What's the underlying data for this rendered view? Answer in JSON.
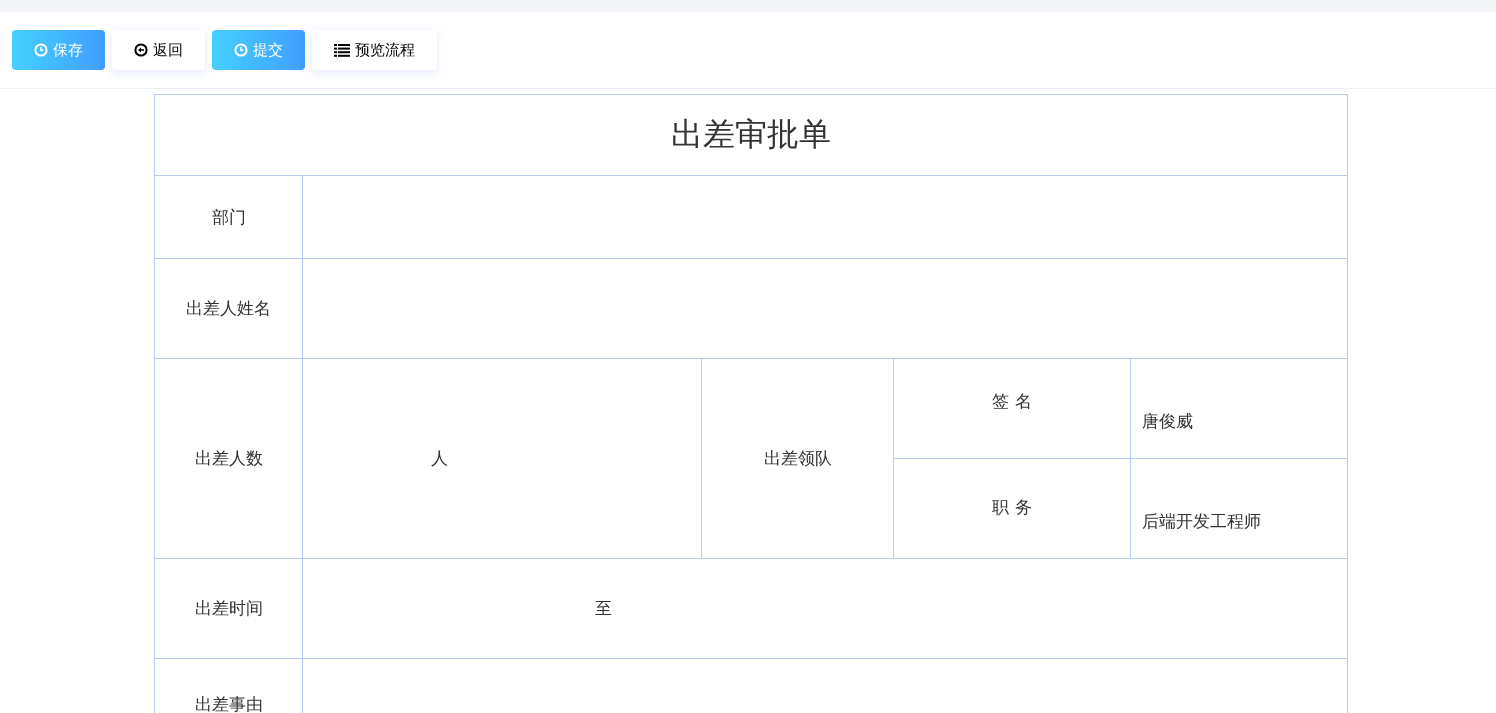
{
  "toolbar": {
    "buttons": [
      {
        "label": "保存",
        "kind": "primary"
      },
      {
        "label": "返回",
        "kind": "default"
      },
      {
        "label": "提交",
        "kind": "primary"
      },
      {
        "label": "预览流程",
        "kind": "default"
      }
    ]
  },
  "form": {
    "title": "出差审批单",
    "department": {
      "label": "部门"
    },
    "traveler_name": {
      "label": "出差人姓名"
    },
    "traveler_count": {
      "label": "出差人数",
      "unit": "人"
    },
    "leader": {
      "label": "出差领队",
      "signature": {
        "label": "签 名",
        "value": "唐俊威"
      },
      "position": {
        "label": "职 务",
        "value": "后端开发工程师"
      }
    },
    "travel_time": {
      "label": "出差时间",
      "separator": "至"
    },
    "reason": {
      "label": "出差事由"
    }
  }
}
